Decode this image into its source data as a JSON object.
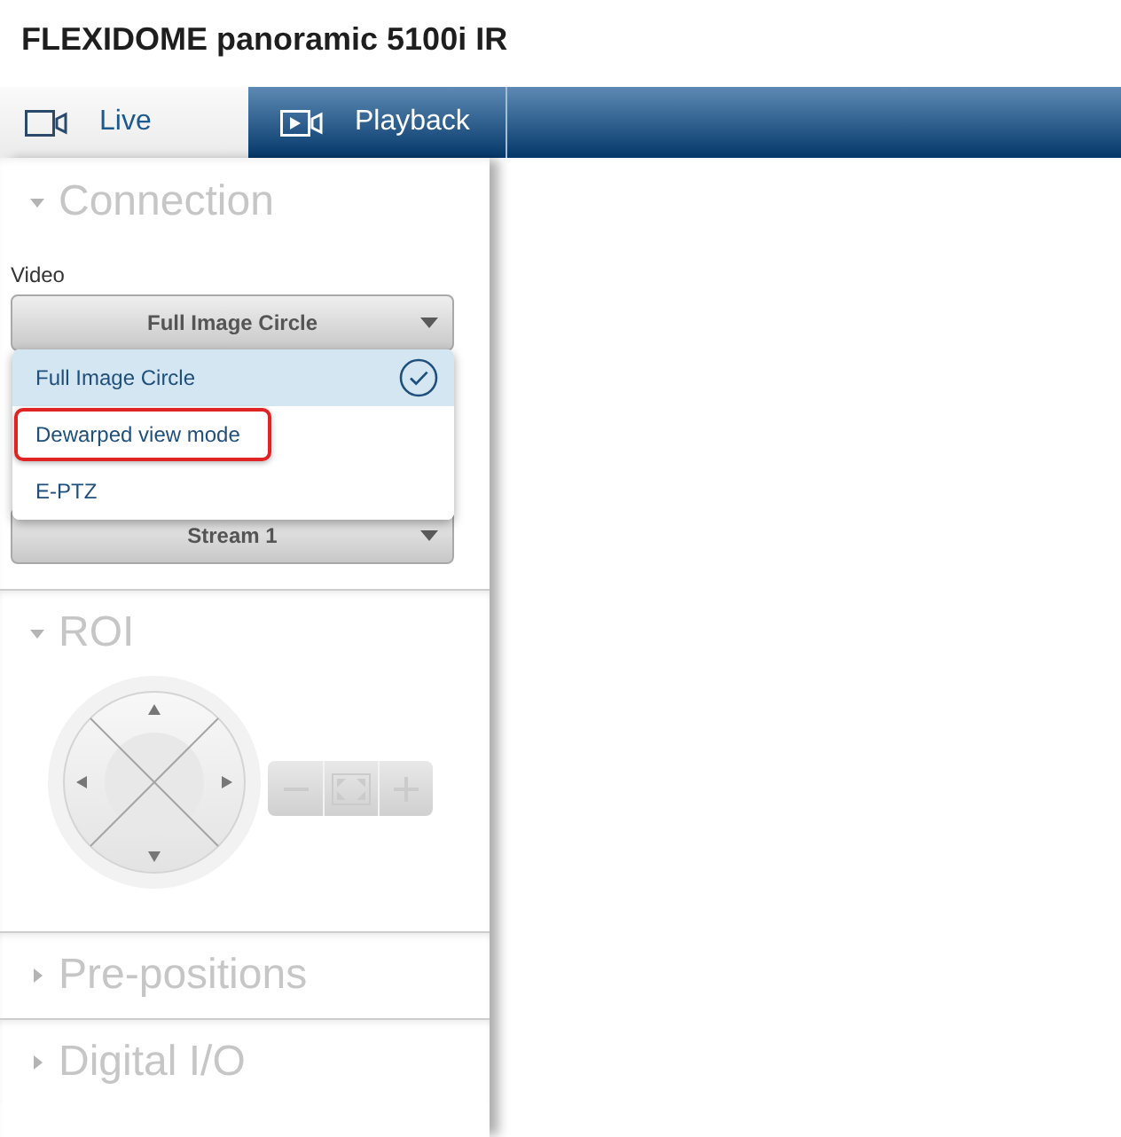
{
  "title": "FLEXIDOME panoramic 5100i IR",
  "tabs": [
    {
      "label": "Live",
      "kind": "live",
      "selected": true
    },
    {
      "label": "Playback",
      "kind": "playback",
      "selected": false
    }
  ],
  "sections": [
    {
      "title": "Connection",
      "kind": "connection",
      "expanded": true,
      "fields": [
        {
          "label": "Video",
          "value": "Full Image Circle",
          "open": true,
          "options": [
            {
              "label": "Full Image Circle",
              "selected": true,
              "highlighted": false
            },
            {
              "label": "Dewarped view mode",
              "selected": false,
              "highlighted": true
            },
            {
              "label": "E-PTZ",
              "selected": false,
              "highlighted": false
            }
          ]
        },
        {
          "value": "Stream 1"
        }
      ]
    },
    {
      "title": "ROI",
      "kind": "ptz",
      "expanded": true,
      "zoom_disabled": true
    },
    {
      "title": "Pre-positions",
      "expanded": false
    },
    {
      "title": "Digital I/O",
      "expanded": false
    }
  ]
}
